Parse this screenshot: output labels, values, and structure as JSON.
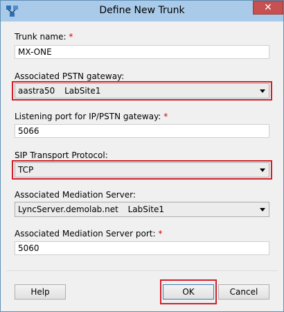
{
  "window": {
    "title": "Define New Trunk",
    "close_label": "✕"
  },
  "fields": {
    "trunk_name": {
      "label": "Trunk name:",
      "required": "*",
      "value": "MX-ONE"
    },
    "gateway": {
      "label": "Associated PSTN gateway:",
      "value_name": "aastra50",
      "value_site": "LabSite1"
    },
    "listening_port": {
      "label": "Listening port for IP/PSTN gateway:",
      "required": "*",
      "value": "5066"
    },
    "sip_transport": {
      "label": "SIP Transport Protocol:",
      "value": "TCP"
    },
    "mediation_server": {
      "label": "Associated Mediation Server:",
      "value_name": "LyncServer.demolab.net",
      "value_site": "LabSite1"
    },
    "mediation_port": {
      "label": "Associated Mediation Server port:",
      "required": "*",
      "value": "5060"
    }
  },
  "buttons": {
    "help": "Help",
    "ok": "OK",
    "cancel": "Cancel"
  },
  "colors": {
    "highlight": "#d1202a",
    "required": "#d40000",
    "titlebar": "#a9cae8"
  }
}
